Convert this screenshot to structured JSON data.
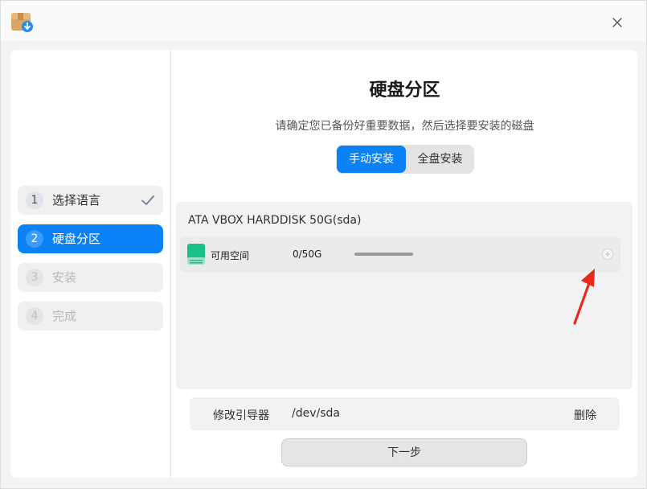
{
  "window": {
    "close_icon": "close-icon",
    "app_icon": "installer-icon"
  },
  "sidebar": {
    "steps": [
      {
        "number": "1",
        "label": "选择语言",
        "state": "done"
      },
      {
        "number": "2",
        "label": "硬盘分区",
        "state": "active"
      },
      {
        "number": "3",
        "label": "安装",
        "state": "todo"
      },
      {
        "number": "4",
        "label": "完成",
        "state": "todo"
      }
    ]
  },
  "main": {
    "title": "硬盘分区",
    "subtitle": "请确定您已备份好重要数据，然后选择要安装的磁盘",
    "modes": [
      {
        "label": "手动安装",
        "selected": true
      },
      {
        "label": "全盘安装",
        "selected": false
      }
    ],
    "disk": {
      "name": "ATA VBOX HARDDISK 50G(sda)",
      "partitions": [
        {
          "name": "可用空间",
          "size": "0/50G",
          "usage": 0
        }
      ]
    },
    "bootloader": {
      "label": "修改引导器",
      "value": "/dev/sda",
      "delete_label": "删除"
    },
    "next_label": "下一步"
  },
  "colors": {
    "accent": "#0a82f5",
    "annotation_arrow": "#e8291c"
  }
}
